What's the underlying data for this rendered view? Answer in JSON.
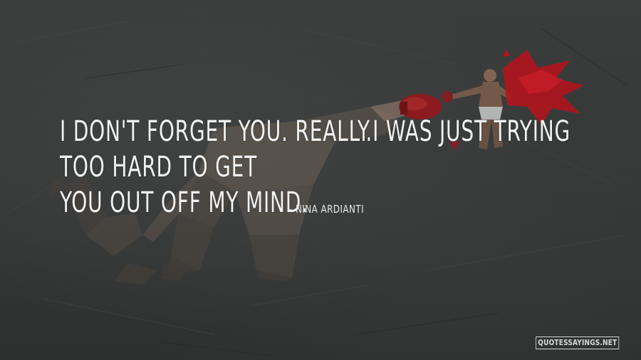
{
  "quote": {
    "line1": "I DON'T FORGET YOU. REALLY.I WAS JUST TRYING TOO HARD TO GET",
    "line2": "YOU OUT OFF MY MIND."
  },
  "author": "- NINA ARDIANTI",
  "watermark": "QUOTESSAYINGS.NET",
  "colors": {
    "background": "#3a3c3c",
    "text": "#f2f2f2",
    "accent_red": "#b8121b"
  },
  "icons": {
    "background_art": "lion-punched-by-boxer-illustration"
  }
}
